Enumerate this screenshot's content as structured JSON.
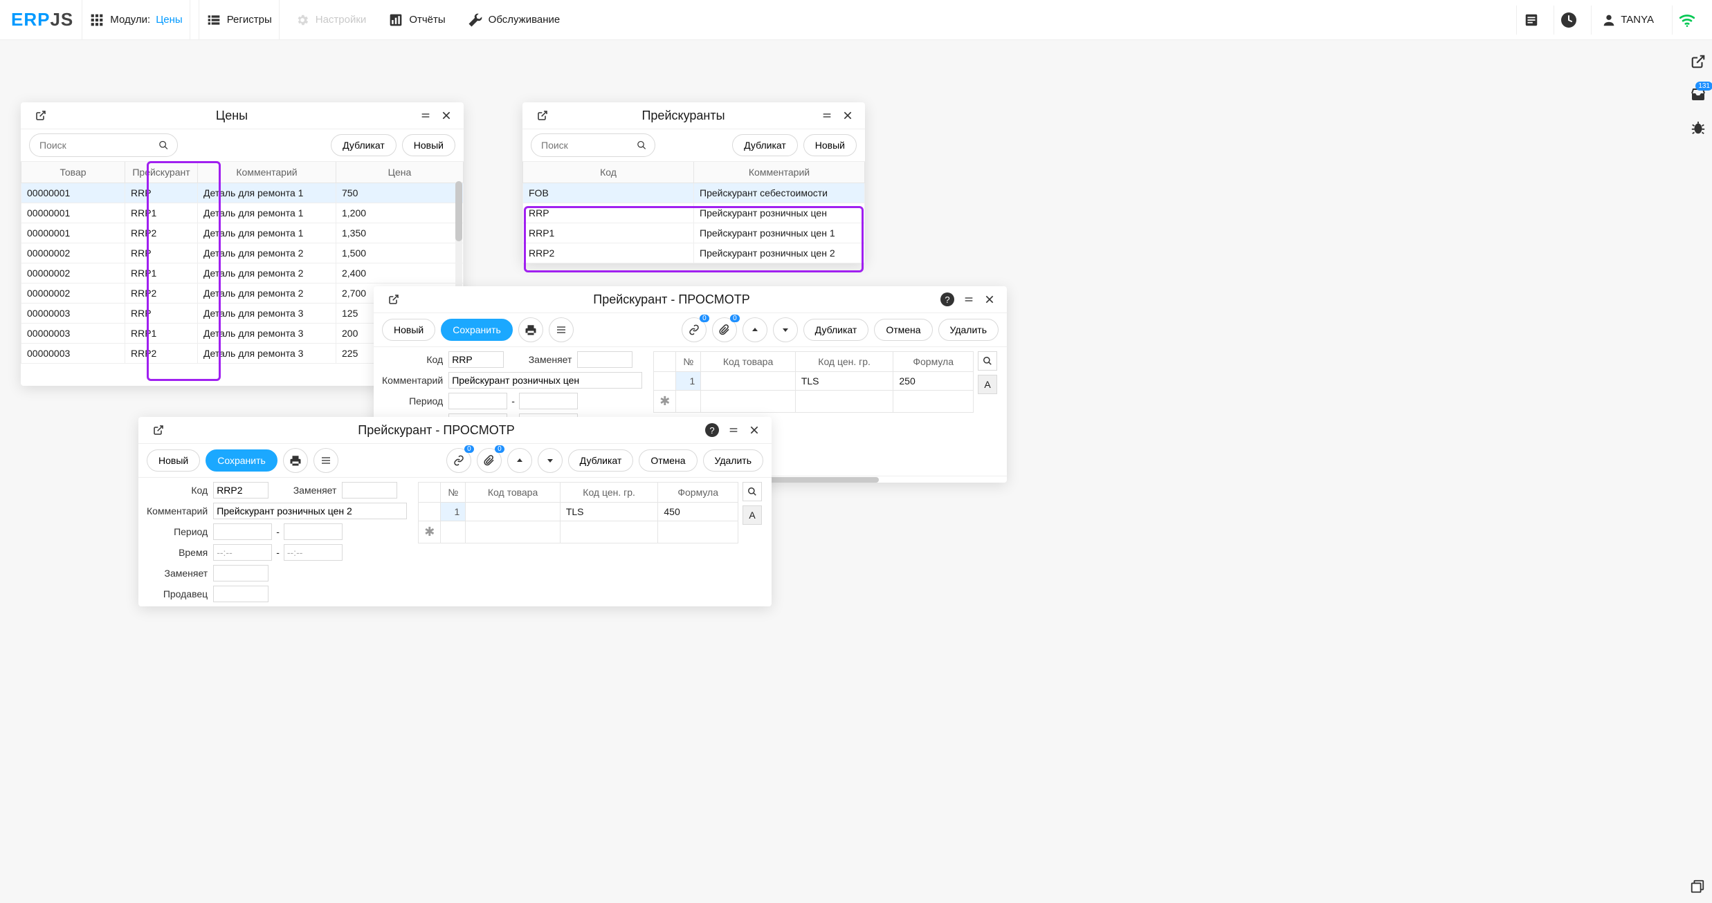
{
  "nav": {
    "logo1": "ERP",
    "logo2": "JS",
    "modules": "Модули:",
    "modules_active": "Цены",
    "registers": "Регистры",
    "settings": "Настройки",
    "reports": "Отчёты",
    "service": "Обслуживание",
    "user": "TANYA",
    "inbox_badge": "131"
  },
  "prices": {
    "title": "Цены",
    "search_ph": "Поиск",
    "dup": "Дубликат",
    "new": "Новый",
    "cols": [
      "Товар",
      "Прейскурант",
      "Комментарий",
      "Цена"
    ],
    "rows": [
      [
        "00000001",
        "RRP",
        "Деталь для ремонта 1",
        "750"
      ],
      [
        "00000001",
        "RRP1",
        "Деталь для ремонта 1",
        "1,200"
      ],
      [
        "00000001",
        "RRP2",
        "Деталь для ремонта 1",
        "1,350"
      ],
      [
        "00000002",
        "RRP",
        "Деталь для ремонта 2",
        "1,500"
      ],
      [
        "00000002",
        "RRP1",
        "Деталь для ремонта 2",
        "2,400"
      ],
      [
        "00000002",
        "RRP2",
        "Деталь для ремонта 2",
        "2,700"
      ],
      [
        "00000003",
        "RRP",
        "Деталь для ремонта 3",
        "125"
      ],
      [
        "00000003",
        "RRP1",
        "Деталь для ремонта 3",
        "200"
      ],
      [
        "00000003",
        "RRP2",
        "Деталь для ремонта 3",
        "225"
      ]
    ]
  },
  "pricelists": {
    "title": "Прейскуранты",
    "search_ph": "Поиск",
    "dup": "Дубликат",
    "new": "Новый",
    "cols": [
      "Код",
      "Комментарий"
    ],
    "rows": [
      [
        "FOB",
        "Прейскурант себестоимости"
      ],
      [
        "RRP",
        "Прейскурант розничных цен"
      ],
      [
        "RRP1",
        "Прейскурант розничных цен 1"
      ],
      [
        "RRP2",
        "Прейскурант розничных цен 2"
      ]
    ]
  },
  "detail": {
    "title": "Прейскурант - ПРОСМОТР",
    "new": "Новый",
    "save": "Сохранить",
    "dup": "Дубликат",
    "cancel": "Отмена",
    "del": "Удалить",
    "badge0": "0",
    "labels": {
      "code": "Код",
      "replaces": "Заменяет",
      "comment": "Комментарий",
      "period": "Период",
      "time": "Время",
      "seller": "Продавец",
      "dash": "-",
      "time_ph": "--:--"
    },
    "rowcols": [
      "№",
      "Код товара",
      "Код цен. гр.",
      "Формула"
    ],
    "tabA": "A"
  },
  "d1": {
    "code": "RRP",
    "comment": "Прейскурант розничных цен",
    "row": [
      "1",
      "",
      "TLS",
      "250"
    ]
  },
  "d2": {
    "code": "RRP2",
    "comment": "Прейскурант розничных цен 2",
    "row": [
      "1",
      "",
      "TLS",
      "450"
    ]
  }
}
